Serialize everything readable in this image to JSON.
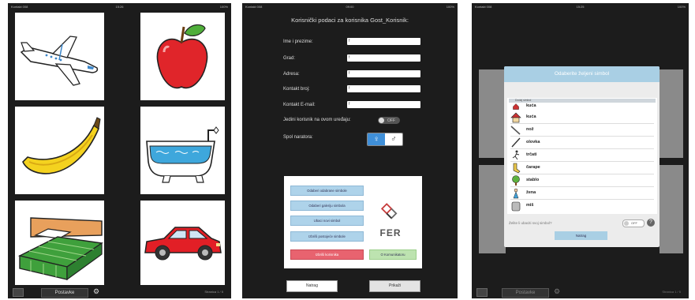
{
  "screen1": {
    "status_left": "Kontakt 008",
    "status_time": "15:26",
    "status_right": "100%",
    "cards": [
      {
        "icon": "airplane-icon"
      },
      {
        "icon": "apple-icon"
      },
      {
        "icon": "banana-icon"
      },
      {
        "icon": "bathtub-icon"
      },
      {
        "icon": "bed-icon"
      },
      {
        "icon": "car-icon"
      }
    ],
    "bottom_button": "Postavke",
    "bottom_right": "Stranica 1 / 5",
    "colors": {
      "apple": "#e0252a",
      "banana": "#f4d21f",
      "bed": "#3fa03c",
      "car": "#e21f26",
      "water": "#3ea7dc"
    }
  },
  "screen2": {
    "status_left": "Kontakt 008",
    "status_time": "09:00",
    "status_right": "100%",
    "title": "Korisnički podaci za korisnika Gost_Korisnik:",
    "fields": [
      {
        "label": "Ime i prezime:",
        "value": "f"
      },
      {
        "label": "Grad:",
        "value": "f"
      },
      {
        "label": "Adresa:",
        "value": "f"
      },
      {
        "label": "Kontakt broj:",
        "value": "f"
      },
      {
        "label": "Kontakt E-mail:",
        "value": "f"
      }
    ],
    "single_user_label": "Jedini korisnik na ovom uređaju:",
    "toggle_value": "OFF",
    "narrator_label": "Spol naratora:",
    "gender_female": "♀",
    "gender_male": "♂",
    "panel_buttons": [
      "Odaberi odabrane simbole",
      "Odaberi galeriju simbola",
      "Ubaci novi simbol",
      "Izbriši postojeće simbole",
      "Izbriši korisnika"
    ],
    "green_button": "O Komunikatoru",
    "logo_text": "FER",
    "back_button": "Natrag",
    "next_button": "Prikaži"
  },
  "screen3": {
    "status_left": "Kontakt 008",
    "status_time": "15:25",
    "status_right": "100%",
    "dialog_title": "Odaberite željeni simbol",
    "selected_row": "Dodaj simbol",
    "items": [
      {
        "label": "kuća",
        "icon": "house-icon"
      },
      {
        "label": "nož",
        "icon": "knife-icon"
      },
      {
        "label": "olovka",
        "icon": "pencil-icon"
      },
      {
        "label": "trčati",
        "icon": "running-icon"
      },
      {
        "label": "čarape",
        "icon": "socks-icon"
      },
      {
        "label": "stablo",
        "icon": "tree-icon"
      },
      {
        "label": "žena",
        "icon": "woman-icon"
      },
      {
        "label": "miš",
        "icon": "mouse-icon"
      }
    ],
    "top_item_partial": "kuća",
    "question": "Želite li ubaciti svoj simbol?",
    "toggle_value": "OFF",
    "help": "?",
    "dialog_button": "Natrag",
    "bottom_button": "Postavke",
    "bottom_right": "Stranica 1 / 5"
  }
}
